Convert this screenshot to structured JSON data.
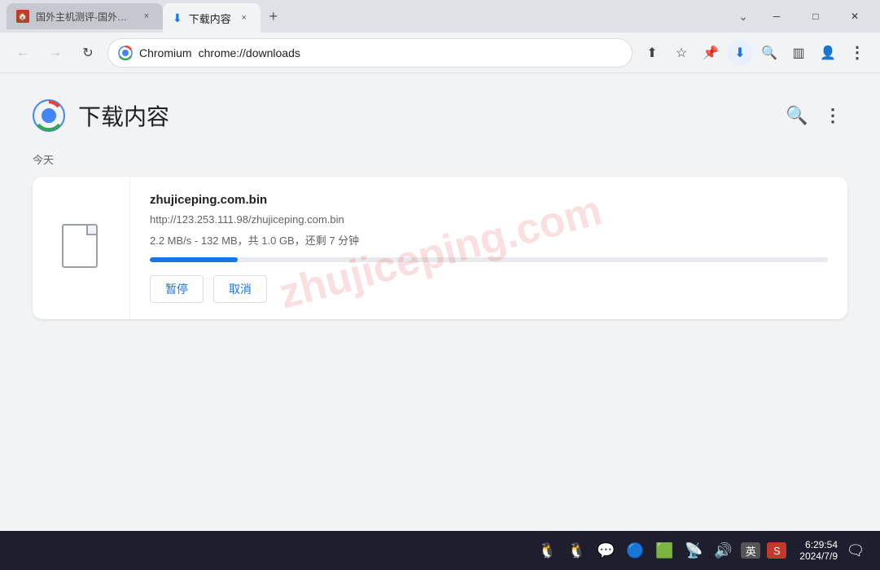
{
  "titlebar": {
    "tab_inactive_label": "国外主机测评-国外VPS、国外...",
    "tab_active_label": "下载内容",
    "tab_close_label": "×",
    "tab_new_label": "+",
    "btn_minimize": "─",
    "btn_restore": "□",
    "btn_close": "✕",
    "chevron_down": "⌄"
  },
  "addressbar": {
    "brand": "Chromium",
    "url": "chrome://downloads",
    "favicon_char": "🔵"
  },
  "page": {
    "title": "下载内容",
    "section_today": "今天",
    "watermark": "zhujiceping.com"
  },
  "download": {
    "filename": "zhujiceping.com.bin",
    "url": "http://123.253.111.98/zhujiceping.com.bin",
    "status": "2.2 MB/s - 132 MB，共 1.0 GB，还剩 7 分钟",
    "progress_percent": 13,
    "btn_pause": "暂停",
    "btn_cancel": "取消"
  },
  "taskbar": {
    "icons": [
      "🐧",
      "🐧",
      "💬",
      "🔵",
      "🟢",
      "📡",
      "🔊",
      "英"
    ],
    "time": "6:29:54",
    "date": "2024/7/9",
    "icon_wechat": "💬",
    "icon_bluetooth": "🔵",
    "icon_nvidia": "🟢",
    "icon_network": "📡",
    "icon_volume": "🔊",
    "icon_ime": "英",
    "icon_sougou": "S"
  }
}
